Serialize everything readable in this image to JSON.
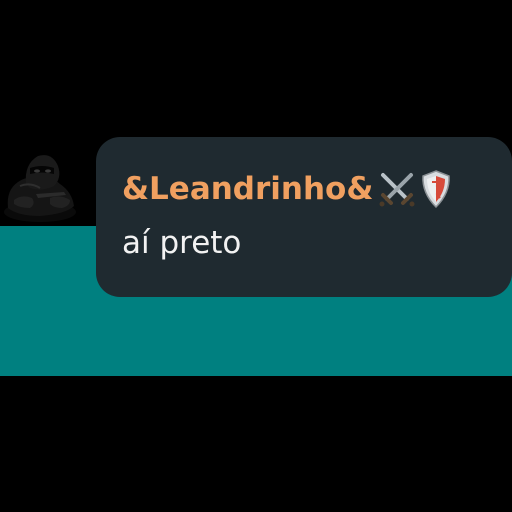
{
  "message": {
    "sender_name": "&Leandrinho&",
    "sender_badges": [
      "crossed-swords-icon",
      "shield-icon"
    ],
    "text": "aí preto"
  },
  "colors": {
    "background": "#000000",
    "teal_band": "#008080",
    "bubble": "#1f2a30",
    "sender_name": "#f0a060",
    "message_text": "#f2f2f2"
  }
}
